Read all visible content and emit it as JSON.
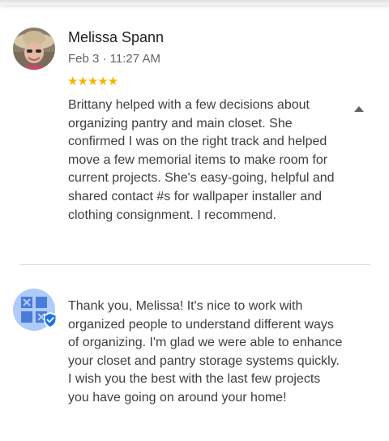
{
  "review": {
    "author": "Melissa Spann",
    "date": "Feb 3 · 11:27 AM",
    "stars": "★★★★★",
    "rating": 5,
    "text": "Brittany helped with a few decisions about organizing pantry and main closet. She confirmed I was on the right track and helped  move a few memorial items to make room for current projects. She's easy-going, helpful and shared contact #s for wallpaper installer and clothing consignment. I recommend."
  },
  "reply": {
    "text": "Thank you, Melissa! It's nice to work with organized people to understand different ways of organizing. I'm glad we were able to enhance your closet and pantry storage systems quickly. I wish you the best with the last few projects you have going on around your home!"
  },
  "icons": {
    "collapse": "caret-up-icon",
    "verified": "verified-badge-icon"
  },
  "colors": {
    "star": "#f4b400",
    "owner_avatar_bg": "#aecbfa",
    "owner_logo": "#4a7bd8",
    "verified_badge": "#1a73e8"
  }
}
